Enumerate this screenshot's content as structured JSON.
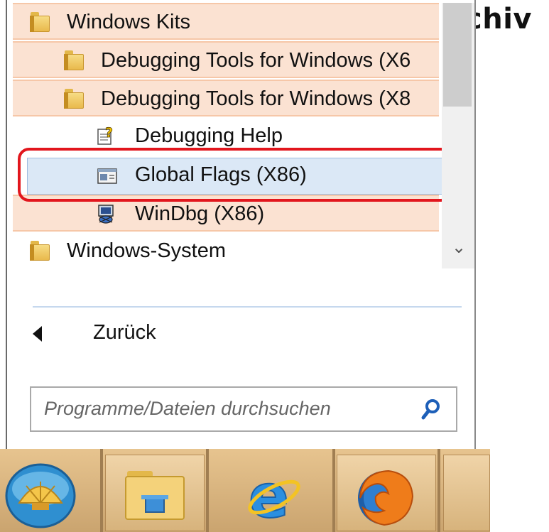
{
  "background": {
    "title_fragment": "chiv"
  },
  "start_menu": {
    "programs": [
      {
        "label": "Windows Kits",
        "icon": "folder-icon",
        "highlighted": true
      },
      {
        "label": "Debugging Tools for Windows (X6",
        "icon": "folder-icon",
        "highlighted": true
      },
      {
        "label": "Debugging Tools for Windows (X8",
        "icon": "folder-icon",
        "highlighted": true
      },
      {
        "label": "Debugging Help",
        "icon": "help-document-icon",
        "highlighted": false
      },
      {
        "label": "Global Flags (X86)",
        "icon": "application-window-icon",
        "selected": true,
        "circled": true
      },
      {
        "label": "WinDbg (X86)",
        "icon": "debugger-icon",
        "highlighted": true
      },
      {
        "label": "Windows-System",
        "icon": "folder-icon",
        "highlighted": false
      }
    ],
    "back": {
      "label": "Zurück",
      "icon": "back-arrow-icon"
    },
    "search": {
      "placeholder": "Programme/Dateien durchsuchen",
      "icon": "search-icon"
    }
  },
  "taskbar": {
    "items": [
      {
        "name": "start-orb",
        "icon": "shell-start-orb-icon"
      },
      {
        "name": "file-explorer",
        "icon": "folder-icon"
      },
      {
        "name": "internet-explorer",
        "icon": "internet-explorer-icon"
      },
      {
        "name": "firefox",
        "icon": "firefox-icon"
      }
    ]
  },
  "colors": {
    "highlight": "#fbe2d2",
    "highlight_border": "#f6c7a8",
    "selection": "#dbe8f6",
    "annotation_ring": "#e2161d",
    "taskbar": "#d9b480"
  }
}
